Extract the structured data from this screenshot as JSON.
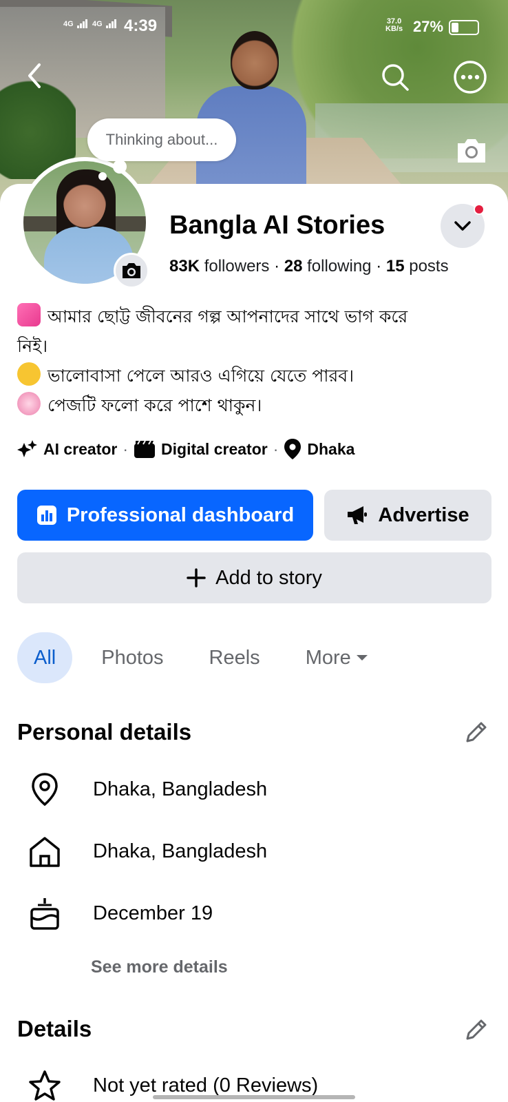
{
  "status_bar": {
    "net1": "4G",
    "net2": "4G",
    "time": "4:39",
    "speed_value": "37.0",
    "speed_unit": "KB/s",
    "battery": "27%"
  },
  "header": {
    "back_icon": "chevron-left-icon",
    "search_icon": "search-icon",
    "more_icon": "more-options-icon",
    "cover_camera_icon": "camera-icon"
  },
  "profile": {
    "thought_bubble": "Thinking about...",
    "name": "Bangla AI Stories",
    "followers_count": "83K",
    "followers_label": "followers",
    "following_count": "28",
    "following_label": "following",
    "posts_count": "15",
    "posts_label": "posts",
    "dot": "·"
  },
  "bio": {
    "line1": "আমার ছোট্ট জীবনের গল্প আপনাদের সাথে ভাগ করে",
    "line1b": "নিই।",
    "line2": "ভালোবাসা পেলে আরও এগিয়ে যেতে পারব।",
    "line3": "পেজটি ফলো করে পাশে থাকুন।"
  },
  "tags": [
    {
      "label": "AI creator",
      "icon": "sparkles-icon"
    },
    {
      "label": "Digital creator",
      "icon": "clapperboard-icon"
    },
    {
      "label": "Dhaka",
      "icon": "location-pin-icon"
    }
  ],
  "actions": {
    "dashboard": "Professional dashboard",
    "advertise": "Advertise",
    "add_story": "Add to story"
  },
  "tabs": [
    "All",
    "Photos",
    "Reels",
    "More"
  ],
  "personal_details": {
    "title": "Personal details",
    "items": [
      {
        "icon": "location-pin-icon",
        "text": "Dhaka, Bangladesh"
      },
      {
        "icon": "home-icon",
        "text": "Dhaka, Bangladesh"
      },
      {
        "icon": "birthday-cake-icon",
        "text": "December 19"
      }
    ],
    "see_more": "See more details"
  },
  "details": {
    "title": "Details",
    "rating": "Not yet rated (0 Reviews)"
  },
  "colors": {
    "primary": "#0866ff",
    "secondary_bg": "#e4e6eb",
    "active_tab_bg": "#dbe7fb",
    "active_tab_text": "#0a5dcc",
    "muted_text": "#65676b",
    "notification": "#e41e3f"
  }
}
